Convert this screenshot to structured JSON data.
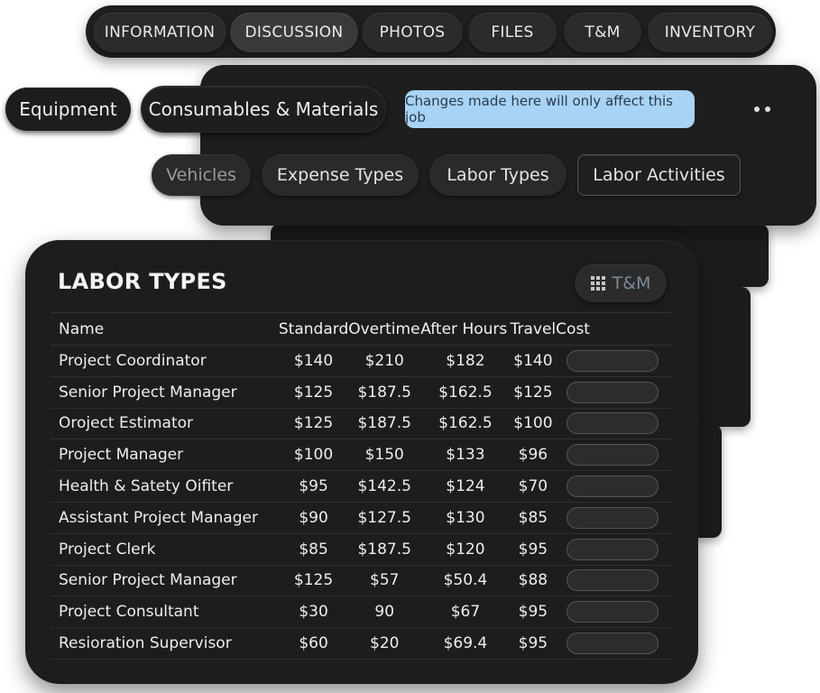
{
  "tabs": [
    "INFORMATION",
    "DISCUSSION",
    "PHOTOS",
    "FILES",
    "T&M",
    "INVENTORY"
  ],
  "category_pills": {
    "equipment": "Equipment",
    "consumables": "Consumables & Materials"
  },
  "notice": "Changes made here will only affect this job",
  "sub_tabs": [
    "Vehicles",
    "Expense Types",
    "Labor Types",
    "Labor Activities"
  ],
  "card": {
    "title": "LABOR TYPES",
    "tm_button": "T&M"
  },
  "table": {
    "headers": [
      "Name",
      "Standard",
      "Overtime",
      "After Hours",
      "Travel",
      "Cost"
    ],
    "rows": [
      [
        "Project Coordinator",
        "$140",
        "$210",
        "$182",
        "$140"
      ],
      [
        "Senior Project Manager",
        "$125",
        "$187.5",
        "$162.5",
        "$125"
      ],
      [
        "Oroject Estimator",
        "$125",
        "$187.5",
        "$162.5",
        "$100"
      ],
      [
        "Project Manager",
        "$100",
        "$150",
        "$133",
        "$96"
      ],
      [
        "Health & Satety Oifiter",
        "$95",
        "$142.5",
        "$124",
        "$70"
      ],
      [
        "Assistant Project Manager",
        "$90",
        "$127.5",
        "$130",
        "$85"
      ],
      [
        "Project Clerk",
        "$85",
        "$187.5",
        "$120",
        "$95"
      ],
      [
        "Senior Project Manager",
        "$125",
        "$57",
        "$50.4",
        "$88"
      ],
      [
        "Project Consultant",
        "$30",
        "90",
        "$67",
        "$95"
      ],
      [
        "Resioration Supervisor",
        "$60",
        "$20",
        "$69.4",
        "$95"
      ]
    ]
  },
  "colors": {
    "notice_bg": "#a8d3f5",
    "panel_bg": "#1d1d1d"
  }
}
